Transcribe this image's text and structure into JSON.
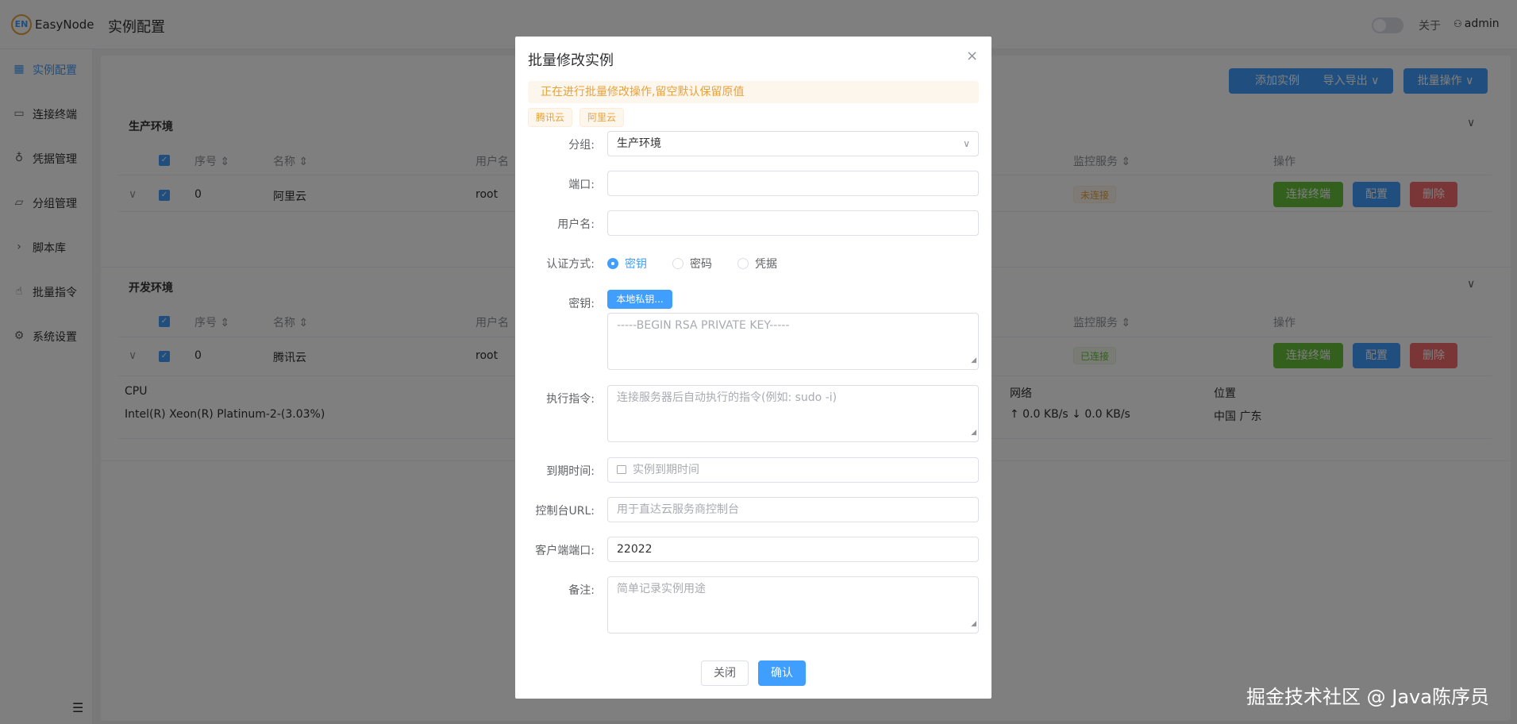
{
  "header": {
    "logo": "EN",
    "app_name": "EasyNode",
    "page_title": "实例配置",
    "about": "关于",
    "user": "admin"
  },
  "sidebar": {
    "items": [
      {
        "label": "实例配置",
        "icon": "grid-icon"
      },
      {
        "label": "连接终端",
        "icon": "terminal-icon"
      },
      {
        "label": "凭据管理",
        "icon": "key-icon"
      },
      {
        "label": "分组管理",
        "icon": "folder-icon"
      },
      {
        "label": "脚本库",
        "icon": "chevron-right-icon"
      },
      {
        "label": "批量指令",
        "icon": "hand-icon"
      },
      {
        "label": "系统设置",
        "icon": "gear-icon"
      }
    ]
  },
  "toolbar": {
    "add": "添加实例",
    "import_export": "导入导出 ∨",
    "batch": "批量操作 ∨"
  },
  "groups": [
    {
      "title": "生产环境",
      "headers": {
        "index": "序号 ⇕",
        "name": "名称 ⇕",
        "user": "用户名",
        "monitor": "监控服务 ⇕",
        "ops": "操作"
      },
      "row": {
        "index": "0",
        "name": "阿里云",
        "user": "root",
        "status": "未连接"
      }
    },
    {
      "title": "开发环境",
      "headers": {
        "index": "序号 ⇕",
        "name": "名称 ⇕",
        "user": "用户名",
        "monitor": "监控服务 ⇕",
        "ops": "操作"
      },
      "row": {
        "index": "0",
        "name": "腾讯云",
        "user": "root",
        "status": "已连接"
      },
      "detail": {
        "cpu_label": "CPU",
        "cpu_value": "Intel(R) Xeon(R) Platinum-2-(3.03%)",
        "net_label": "网络",
        "net_value": "↑ 0.0 KB/s ↓ 0.0 KB/s",
        "loc_label": "位置",
        "loc_value": "中国 广东"
      }
    }
  ],
  "row_buttons": {
    "connect": "连接终端",
    "config": "配置",
    "delete": "删除"
  },
  "dialog": {
    "title": "批量修改实例",
    "alert": "正在进行批量修改操作,留空默认保留原值",
    "chips": [
      "腾讯云",
      "阿里云"
    ],
    "fields": {
      "group": {
        "label": "分组:",
        "value": "生产环境"
      },
      "port": {
        "label": "端口:",
        "value": ""
      },
      "username": {
        "label": "用户名:",
        "value": ""
      },
      "auth": {
        "label": "认证方式:",
        "options": [
          "密钥",
          "密码",
          "凭据"
        ],
        "selected": "密钥"
      },
      "key": {
        "label": "密钥:",
        "button": "本地私钥...",
        "placeholder": "-----BEGIN RSA PRIVATE KEY-----"
      },
      "command": {
        "label": "执行指令:",
        "placeholder": "连接服务器后自动执行的指令(例如: sudo -i)"
      },
      "expire": {
        "label": "到期时间:",
        "placeholder": "实例到期时间"
      },
      "console_url": {
        "label": "控制台URL:",
        "placeholder": "用于直达云服务商控制台"
      },
      "client_port": {
        "label": "客户端端口:",
        "value": "22022"
      },
      "remark": {
        "label": "备注:",
        "placeholder": "简单记录实例用途"
      }
    },
    "close": "关闭",
    "confirm": "确认"
  },
  "watermark": "掘金技术社区 @ Java陈序员"
}
